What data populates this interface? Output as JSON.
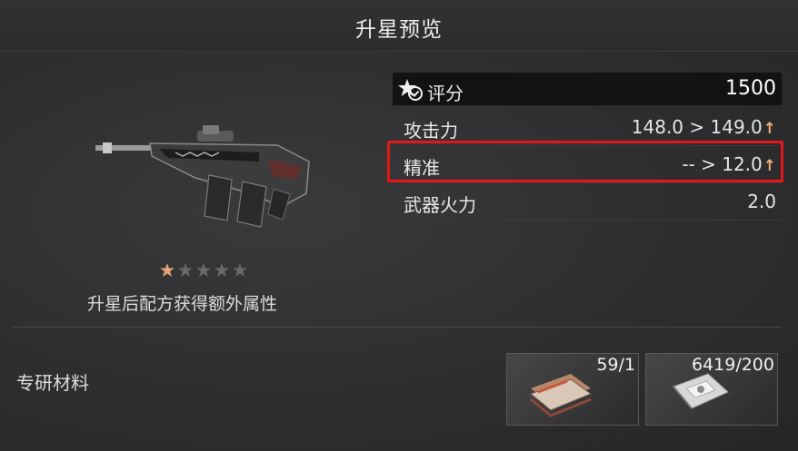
{
  "header": {
    "title": "升星预览"
  },
  "weapon": {
    "star_caption": "升星后配方获得额外属性",
    "stars": [
      {
        "state": "filled",
        "color": "#e8a478"
      },
      {
        "state": "empty",
        "color": "#6a6a6c"
      },
      {
        "state": "empty",
        "color": "#6a6a6c"
      },
      {
        "state": "empty",
        "color": "#6a6a6c"
      },
      {
        "state": "empty",
        "color": "#6a6a6c"
      }
    ]
  },
  "stats": {
    "score": {
      "label": "评分",
      "value": "1500",
      "icon": "star-check-icon"
    },
    "attack": {
      "label": "攻击力",
      "value": "148.0 > 149.0",
      "arrow": "↑"
    },
    "accuracy": {
      "label": "精准",
      "value": "-- > 12.0",
      "arrow": "↑"
    },
    "firepower": {
      "label": "武器火力",
      "value": "2.0"
    }
  },
  "materials": {
    "label": "专研材料",
    "items": [
      {
        "name": "blueprint-bundle-icon",
        "count": "59/1"
      },
      {
        "name": "parts-packet-icon",
        "count": "6419/200"
      }
    ]
  },
  "colors": {
    "highlight_border": "#e31717",
    "upgrade_arrow": "#f1b27a",
    "score_bg": "#121213"
  }
}
